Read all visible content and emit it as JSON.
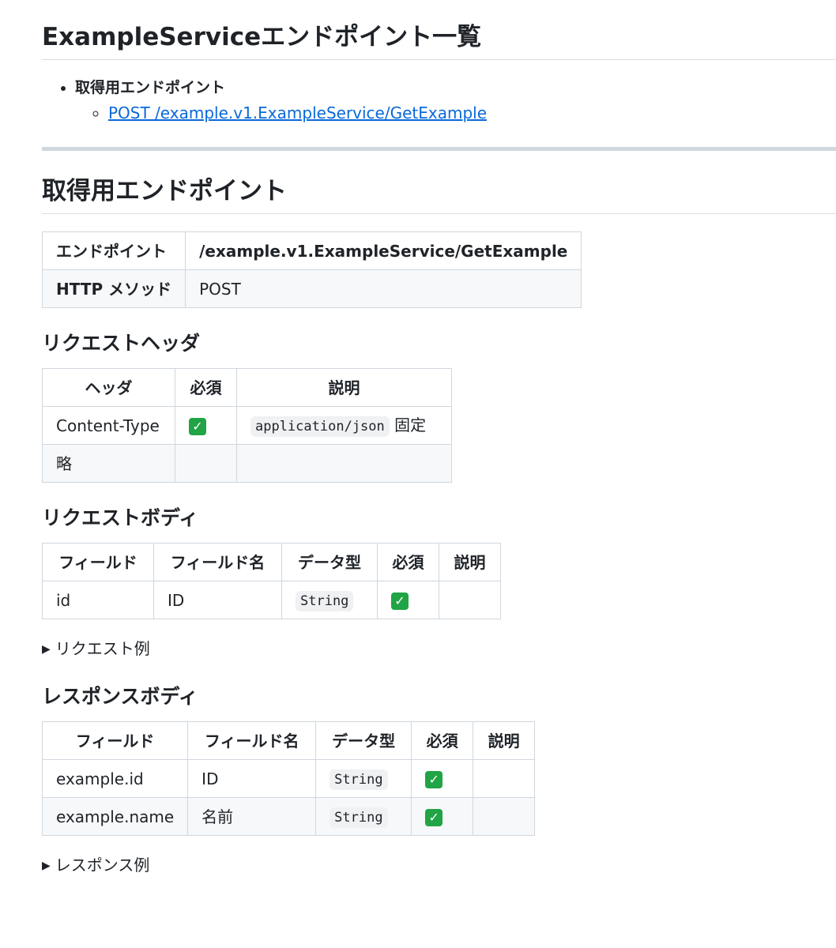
{
  "page_title": "ExampleServiceエンドポイント一覧",
  "toc": {
    "section_label": "取得用エンドポイント",
    "link_label": "POST /example.v1.ExampleService/GetExample"
  },
  "section": {
    "title": "取得用エンドポイント",
    "info_table": {
      "rows": [
        {
          "label": "エンドポイント",
          "value": "/example.v1.ExampleService/GetExample"
        },
        {
          "label": "HTTP メソッド",
          "value": "POST"
        }
      ]
    },
    "request_header": {
      "title": "リクエストヘッダ",
      "columns": [
        "ヘッダ",
        "必須",
        "説明"
      ],
      "rows": [
        {
          "header": "Content-Type",
          "required": "✓",
          "desc_code": "application/json",
          "desc_text": " 固定"
        },
        {
          "header": "略",
          "required": "",
          "desc_code": "",
          "desc_text": ""
        }
      ]
    },
    "request_body": {
      "title": "リクエストボディ",
      "columns": [
        "フィールド",
        "フィールド名",
        "データ型",
        "必須",
        "説明"
      ],
      "rows": [
        {
          "field": "id",
          "name": "ID",
          "type": "String",
          "required": "✓",
          "desc": ""
        }
      ],
      "example_label": "リクエスト例"
    },
    "response_body": {
      "title": "レスポンスボディ",
      "columns": [
        "フィールド",
        "フィールド名",
        "データ型",
        "必須",
        "説明"
      ],
      "rows": [
        {
          "field": "example.id",
          "name": "ID",
          "type": "String",
          "required": "✓",
          "desc": ""
        },
        {
          "field": "example.name",
          "name": "名前",
          "type": "String",
          "required": "✓",
          "desc": ""
        }
      ],
      "example_label": "レスポンス例"
    }
  },
  "colors": {
    "link": "#0969da",
    "border": "#d0d7de",
    "check": "#21a445"
  }
}
